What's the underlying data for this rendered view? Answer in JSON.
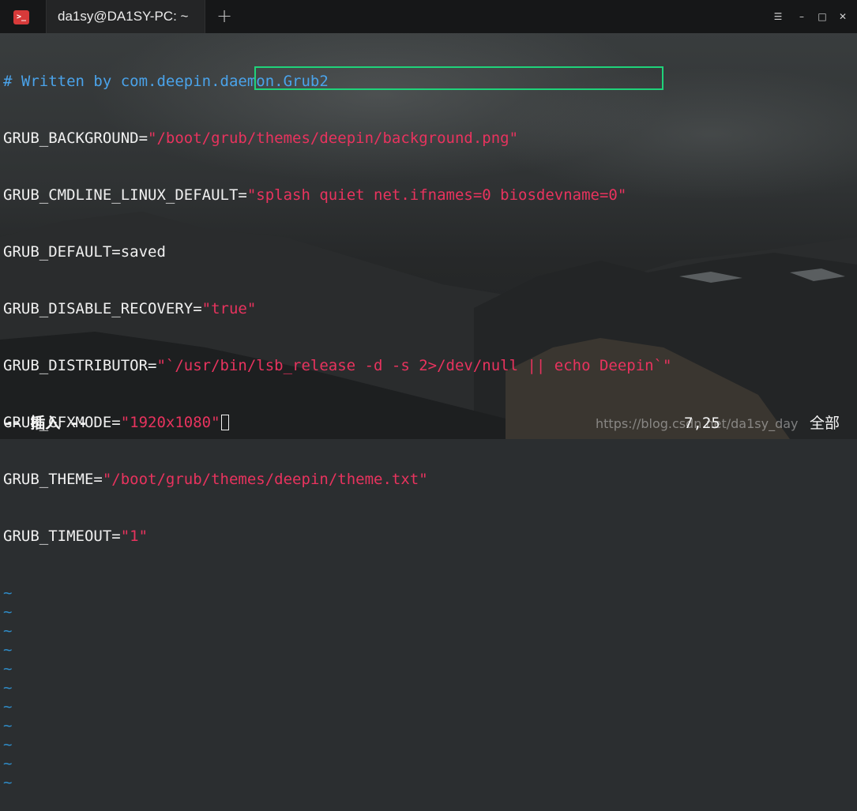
{
  "window": {
    "tab_title": "da1sy@DA1SY-PC: ~",
    "app_icon_glyph": ">_",
    "new_tab_glyph": "+",
    "controls": {
      "menu": "☰",
      "minimize": "–",
      "maximize": "□",
      "close": "✕"
    }
  },
  "editor": {
    "comment": "# Written by com.deepin.daemon.Grub2",
    "lines": [
      {
        "key": "GRUB_BACKGROUND=",
        "value": "\"/boot/grub/themes/deepin/background.png\""
      },
      {
        "key": "GRUB_CMDLINE_LINUX_DEFAULT=",
        "value": "\"splash quiet net.ifnames=0 biosdevname=0\""
      },
      {
        "key": "GRUB_DEFAULT=saved",
        "value": ""
      },
      {
        "key": "GRUB_DISABLE_RECOVERY=",
        "value": "\"true\""
      },
      {
        "key": "GRUB_DISTRIBUTOR=",
        "value": "\"`/usr/bin/lsb_release -d -s 2>/dev/null || echo Deepin`\""
      },
      {
        "key": "GRUB_GFXMODE=",
        "value": "\"1920x1080\""
      },
      {
        "key": "GRUB_THEME=",
        "value": "\"/boot/grub/themes/deepin/theme.txt\""
      },
      {
        "key": "GRUB_TIMEOUT=",
        "value": "\"1\""
      }
    ],
    "tilde": "~",
    "empty_line_count": 11
  },
  "status": {
    "mode": "-- 插入 --",
    "cursor_pos": "7,25",
    "scroll": "全部",
    "watermark": "https://blog.csdn.net/da1sy_day"
  },
  "colors": {
    "comment": "#4aa3ea",
    "string": "#e8335e",
    "tilde": "#2f8cc8",
    "highlight_box": "#1fd37a"
  }
}
